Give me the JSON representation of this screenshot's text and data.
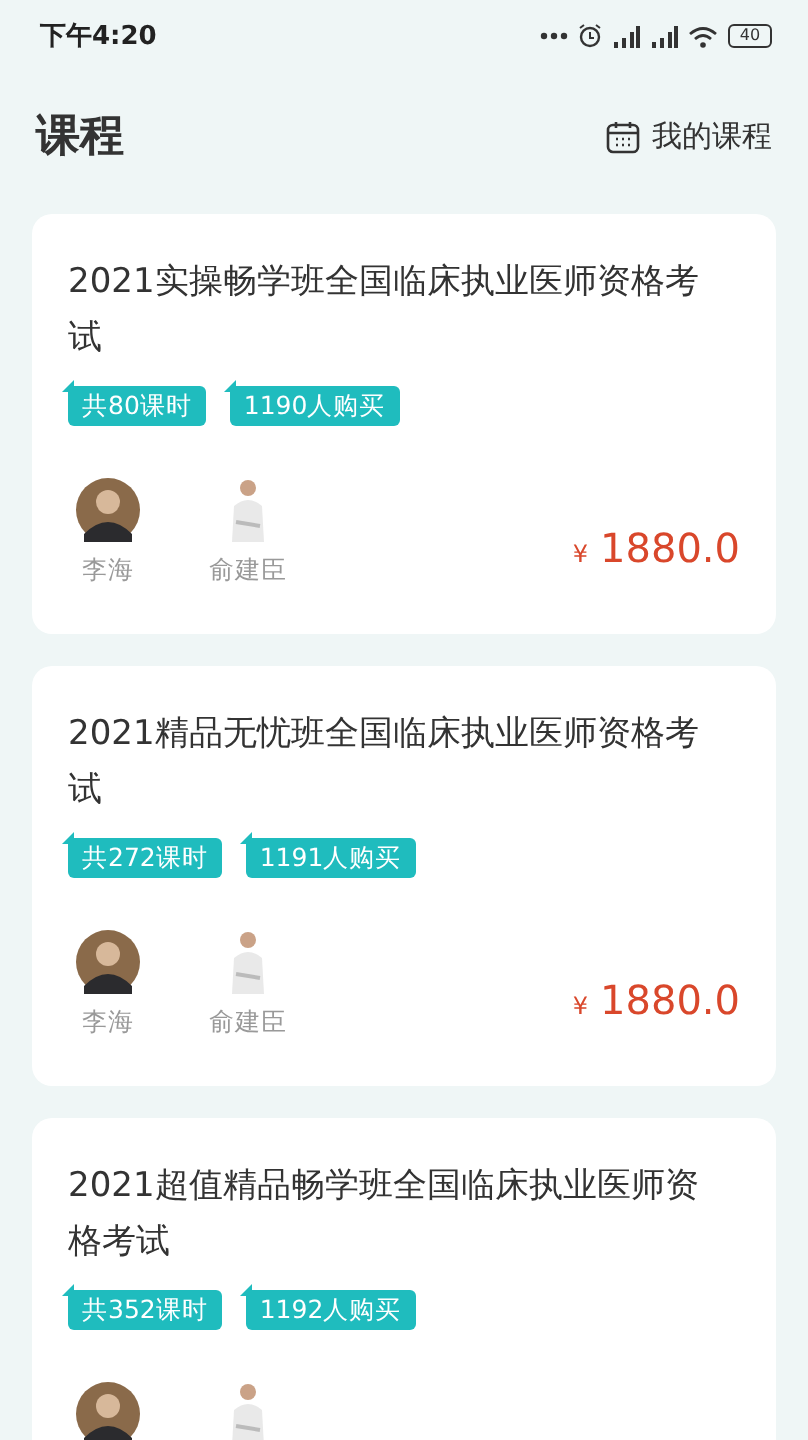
{
  "status_bar": {
    "time": "下午4:20",
    "battery": "40"
  },
  "header": {
    "title": "课程",
    "my_courses": "我的课程"
  },
  "courses": [
    {
      "title": "2021实操畅学班全国临床执业医师资格考试",
      "tags": [
        "共80课时",
        "1190人购买"
      ],
      "teachers": [
        {
          "name": "李海",
          "kind": "round"
        },
        {
          "name": "俞建臣",
          "kind": "standing"
        }
      ],
      "currency": "¥",
      "price": "1880.0"
    },
    {
      "title": "2021精品无忧班全国临床执业医师资格考试",
      "tags": [
        "共272课时",
        "1191人购买"
      ],
      "teachers": [
        {
          "name": "李海",
          "kind": "round"
        },
        {
          "name": "俞建臣",
          "kind": "standing"
        }
      ],
      "currency": "¥",
      "price": "1880.0"
    },
    {
      "title": "2021超值精品畅学班全国临床执业医师资格考试",
      "tags": [
        "共352课时",
        "1192人购买"
      ],
      "teachers": [
        {
          "kind": "round"
        },
        {
          "kind": "standing"
        }
      ]
    }
  ]
}
